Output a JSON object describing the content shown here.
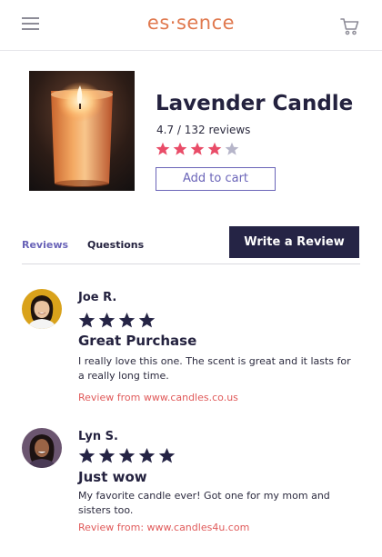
{
  "header": {
    "logo": "es·sence",
    "menu_icon": "hamburger-menu-icon",
    "cart_icon": "shopping-cart-icon"
  },
  "product": {
    "title": "Lavender Candle",
    "rating": "4.7",
    "separator": " / ",
    "review_count": "132 reviews",
    "stars_filled": 4,
    "stars_total": 5,
    "star_color": "#e94c68",
    "star_empty_color": "#b6b5c9",
    "add_to_cart_label": "Add to cart"
  },
  "tabs": {
    "reviews": "Reviews",
    "questions": "Questions",
    "active_color": "#6a64b8"
  },
  "write_review_label": "Write a Review",
  "reviews": [
    {
      "name": "Joe R.",
      "stars": 4,
      "title": "Great Purchase",
      "body": "I really love this one. The scent is great and it lasts for a really long time.",
      "source": "Review from www.candles.co.us"
    },
    {
      "name": "Lyn S.",
      "stars": 5,
      "title": "Just wow",
      "body": "My favorite candle ever! Got one for my mom and sisters too.",
      "source": "Review from: www.candles4u.com"
    }
  ],
  "colors": {
    "brand": "#e0794f",
    "dark": "#252445",
    "accent": "#6a64b8",
    "source_link": "#e05a5a"
  }
}
